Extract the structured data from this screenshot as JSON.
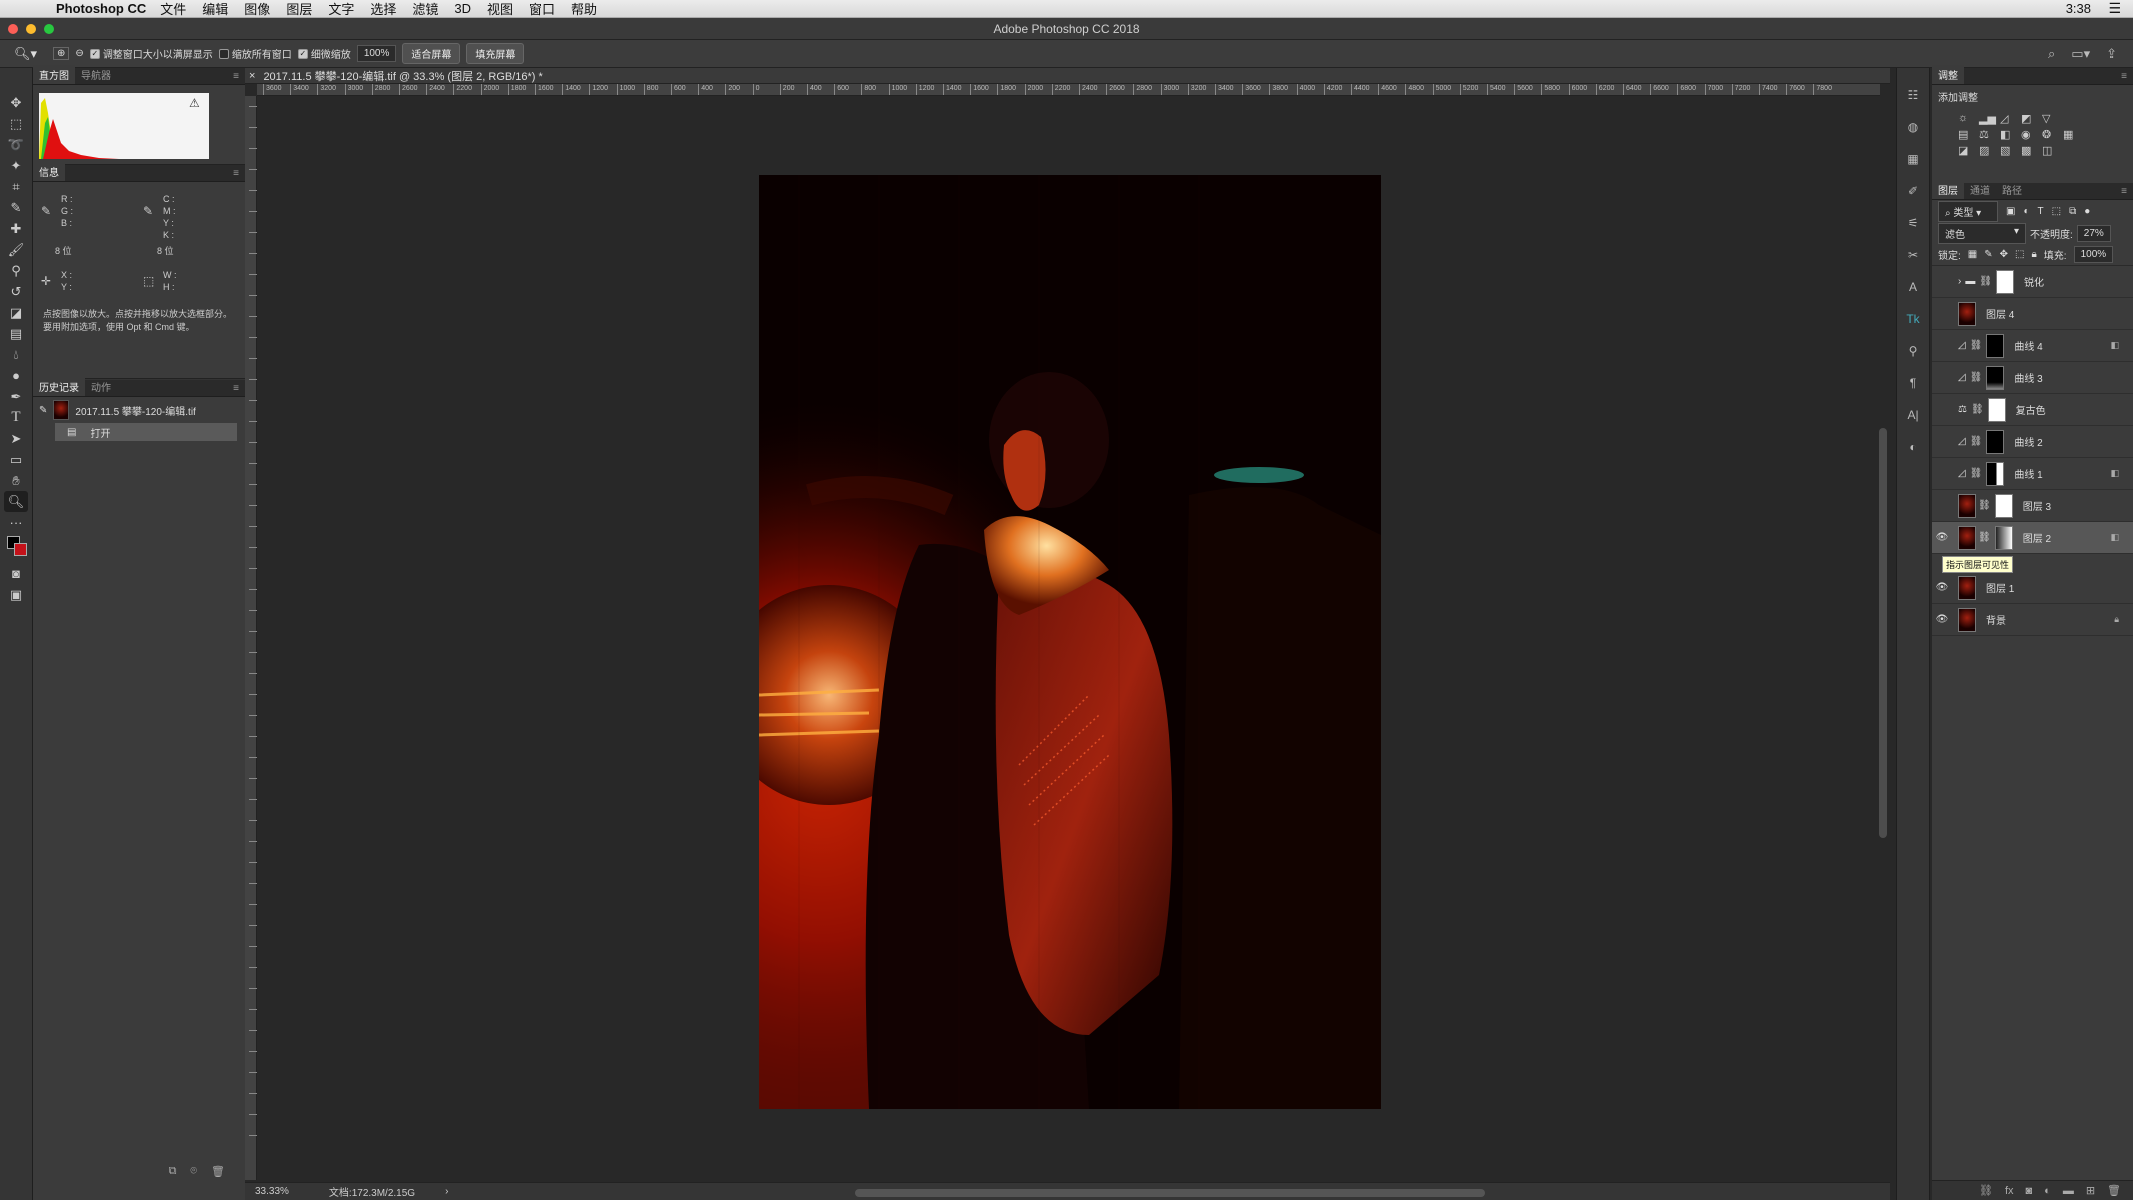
{
  "menubar": {
    "app_name": "Photoshop CC",
    "items": [
      "文件",
      "编辑",
      "图像",
      "图层",
      "文字",
      "选择",
      "滤镜",
      "3D",
      "视图",
      "窗口",
      "帮助"
    ],
    "clock": "3:38"
  },
  "window": {
    "title": "Adobe Photoshop CC 2018"
  },
  "options": {
    "resize_windows": "调整窗口大小以满屏显示",
    "zoom_all": "缩放所有窗口",
    "scrubby_zoom": "细微缩放",
    "zoom_value": "100%",
    "fit_screen": "适合屏幕",
    "fill_screen": "填充屏幕"
  },
  "left_panels": {
    "histogram_tab": "直方图",
    "navigator_tab": "导航器",
    "info_tab": "信息",
    "info": {
      "r": "R :",
      "g": "G :",
      "b": "B :",
      "c": "C :",
      "m": "M :",
      "y": "Y :",
      "k": "K :",
      "bits_left": "8 位",
      "bits_right": "8 位",
      "x": "X :",
      "y_coord": "Y :",
      "w": "W :",
      "h": "H :",
      "hint": "点按图像以放大。点按并拖移以放大选框部分。要用附加选项，使用 Opt 和 Cmd 键。"
    },
    "history_tab": "历史记录",
    "actions_tab": "动作",
    "history_items": [
      "2017.11.5 攀攀-120-编辑.tif",
      "打开"
    ]
  },
  "document": {
    "tab_title": "2017.11.5 攀攀-120-编辑.tif @ 33.3% (图层 2, RGB/16*) *",
    "ruler_labels": [
      "3600",
      "3400",
      "3200",
      "3000",
      "2800",
      "2600",
      "2400",
      "2200",
      "2000",
      "1800",
      "1600",
      "1400",
      "1200",
      "1000",
      "800",
      "600",
      "400",
      "200",
      "0",
      "200",
      "400",
      "600",
      "800",
      "1000",
      "1200",
      "1400",
      "1600",
      "1800",
      "2000",
      "2200",
      "2400",
      "2600",
      "2800",
      "3000",
      "3200",
      "3400",
      "3600",
      "3800",
      "4000",
      "4200",
      "4400",
      "4600",
      "4800",
      "5000",
      "5200",
      "5400",
      "5600",
      "5800",
      "6000",
      "6200",
      "6400",
      "6600",
      "6800",
      "7000",
      "7200",
      "7400",
      "7600",
      "7800"
    ],
    "zoom_status": "33.33%",
    "doc_status": "文档:172.3M/2.15G"
  },
  "right_panel": {
    "adjustments_tab": "调整",
    "add_adjustment": "添加调整",
    "layers_tab": "图层",
    "channels_tab": "通道",
    "paths_tab": "路径",
    "filter_kind": "类型",
    "blend_mode": "滤色",
    "opacity_label": "不透明度:",
    "opacity_value": "27%",
    "lock_label": "锁定:",
    "fill_label": "填充:",
    "fill_value": "100%",
    "tooltip": "指示图层可见性",
    "layers": [
      {
        "name": "锐化",
        "visible": false,
        "kind": "group"
      },
      {
        "name": "图层 4",
        "visible": false,
        "kind": "pixel"
      },
      {
        "name": "曲线 4",
        "visible": false,
        "kind": "curves"
      },
      {
        "name": "曲线 3",
        "visible": false,
        "kind": "curves"
      },
      {
        "name": "复古色",
        "visible": false,
        "kind": "colorbalance"
      },
      {
        "name": "曲线 2",
        "visible": false,
        "kind": "curves"
      },
      {
        "name": "曲线 1",
        "visible": false,
        "kind": "curves"
      },
      {
        "name": "图层 3",
        "visible": false,
        "kind": "pixel"
      },
      {
        "name": "图层 2",
        "visible": true,
        "kind": "pixel",
        "selected": true
      },
      {
        "name": "图层 1",
        "visible": true,
        "kind": "pixel"
      },
      {
        "name": "背景",
        "visible": true,
        "kind": "background"
      }
    ]
  }
}
